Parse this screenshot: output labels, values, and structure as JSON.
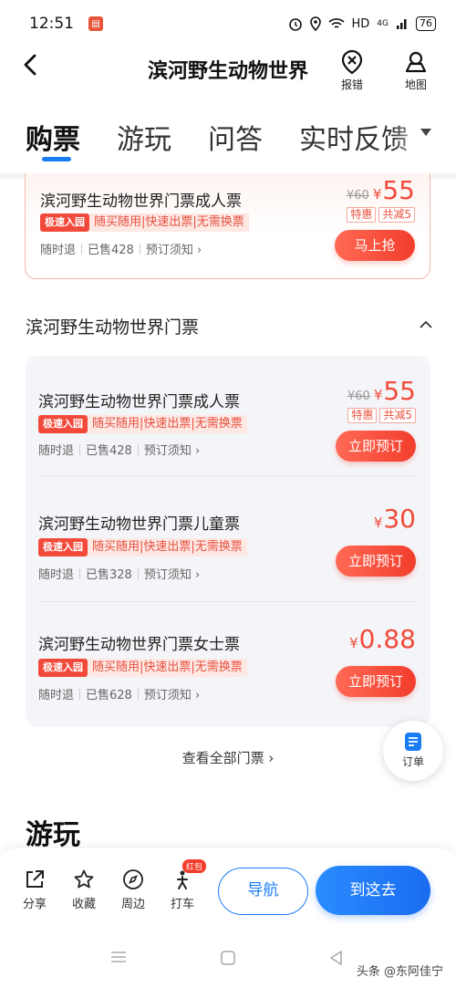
{
  "status_bar": {
    "time": "12:51",
    "network": "HD",
    "signal": "4G",
    "battery": "76"
  },
  "header": {
    "title": "滨河野生动物世界",
    "report_label": "报错",
    "map_label": "地图"
  },
  "tabs": [
    {
      "label": "购票",
      "active": true
    },
    {
      "label": "游玩"
    },
    {
      "label": "问答"
    },
    {
      "label": "实时反馈"
    }
  ],
  "featured": {
    "name": "滨河野生动物世界门票成人票",
    "speed_tag": "极速入园",
    "features": "随买随用|快速出票|无需换票",
    "refund": "随时退",
    "sold": "已售428",
    "notice": "预订须知",
    "orig_price": "¥60",
    "price_yen": "¥",
    "price": "55",
    "chip1": "特惠",
    "chip2": "共减5",
    "button": "马上抢"
  },
  "section": {
    "title": "滨河野生动物世界门票"
  },
  "tickets": [
    {
      "name": "滨河野生动物世界门票成人票",
      "speed_tag": "极速入园",
      "features": "随买随用|快速出票|无需换票",
      "refund": "随时退",
      "sold": "已售428",
      "notice": "预订须知",
      "orig_price": "¥60",
      "price_yen": "¥",
      "price": "55",
      "chip1": "特惠",
      "chip2": "共减5",
      "button": "立即预订"
    },
    {
      "name": "滨河野生动物世界门票儿童票",
      "speed_tag": "极速入园",
      "features": "随买随用|快速出票|无需换票",
      "refund": "随时退",
      "sold": "已售328",
      "notice": "预订须知",
      "price_yen": "¥",
      "price": "30",
      "button": "立即预订"
    },
    {
      "name": "滨河野生动物世界门票女士票",
      "speed_tag": "极速入园",
      "features": "随买随用|快速出票|无需换票",
      "refund": "随时退",
      "sold": "已售628",
      "notice": "预订须知",
      "price_yen": "¥",
      "price": "0.88",
      "button": "立即预订"
    }
  ],
  "view_all": "查看全部门票",
  "float_order": "订单",
  "section2_title": "游玩",
  "bottom_bar": {
    "share": "分享",
    "favorite": "收藏",
    "nearby": "周边",
    "taxi": "打车",
    "taxi_badge": "红包",
    "navigate": "导航",
    "go_here": "到这去"
  },
  "watermark": "头条 @东阿佳宁",
  "colors": {
    "accent_blue": "#1a7cf5",
    "price_red": "#f24a3a"
  }
}
